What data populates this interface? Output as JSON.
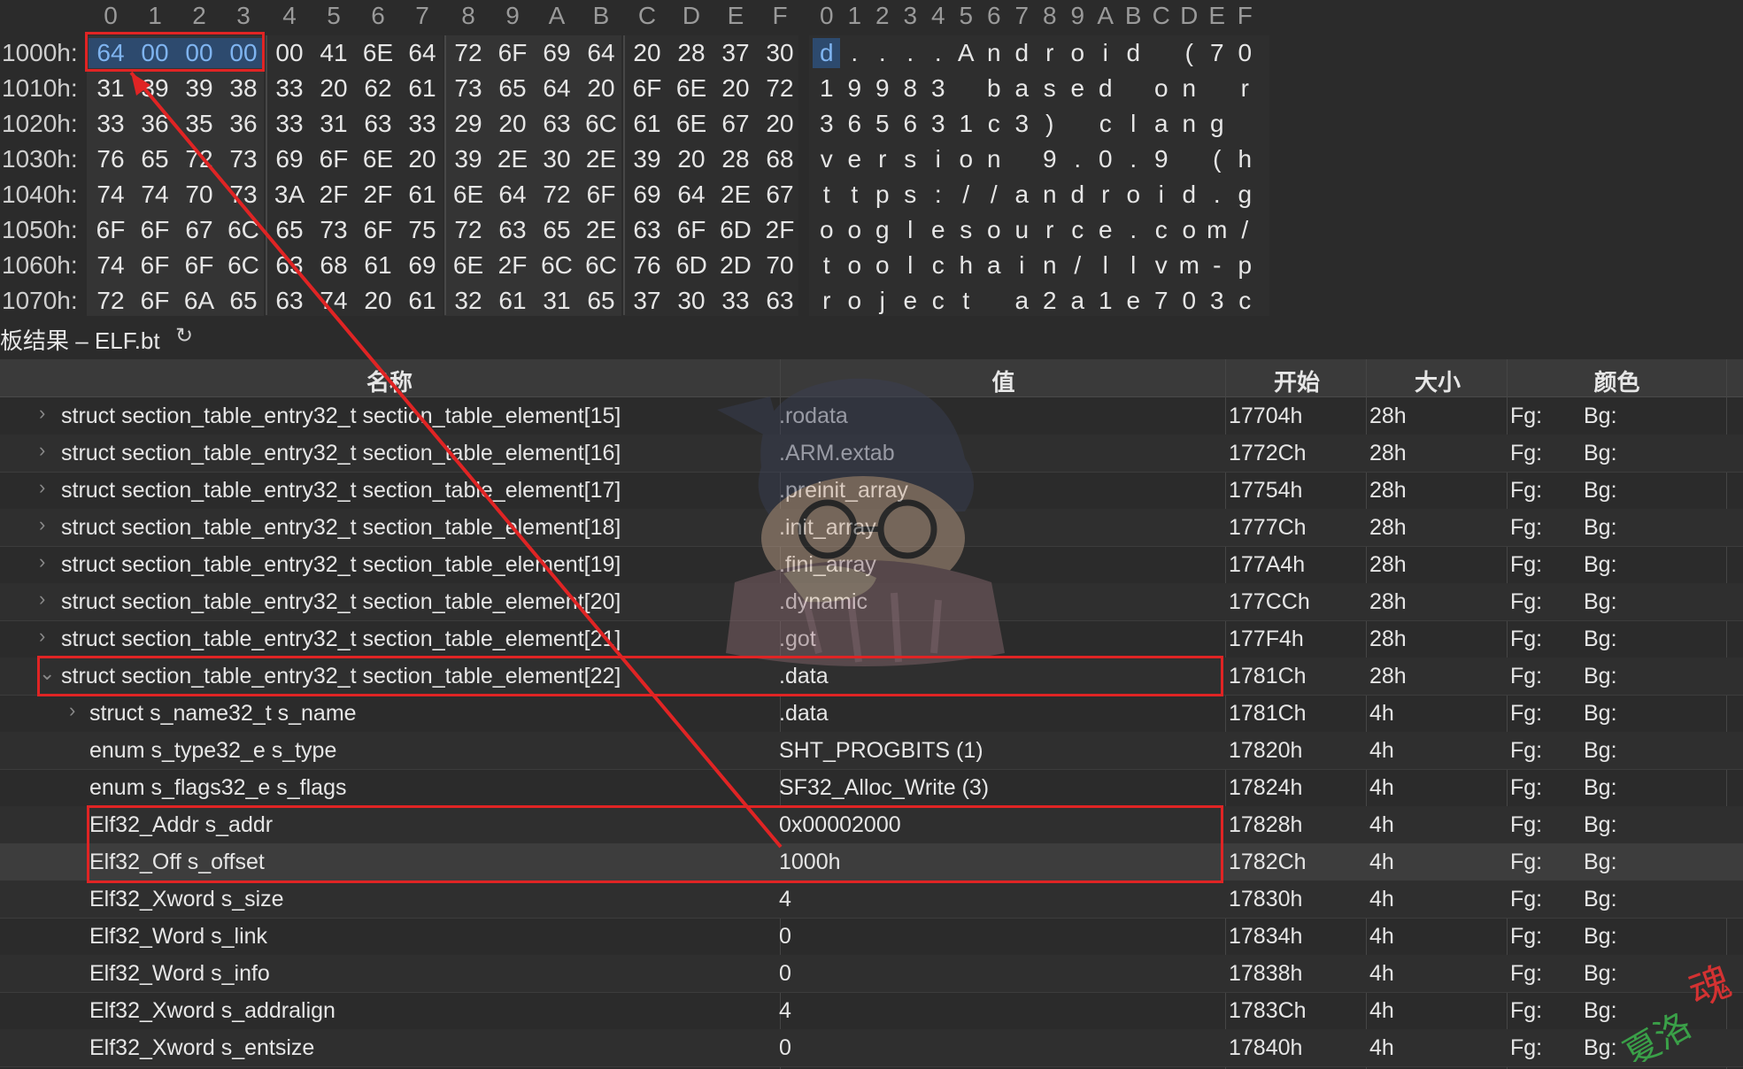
{
  "hex_view": {
    "column_headers": [
      "0",
      "1",
      "2",
      "3",
      "4",
      "5",
      "6",
      "7",
      "8",
      "9",
      "A",
      "B",
      "C",
      "D",
      "E",
      "F"
    ],
    "ascii_headers": [
      "0",
      "1",
      "2",
      "3",
      "4",
      "5",
      "6",
      "7",
      "8",
      "9",
      "A",
      "B",
      "C",
      "D",
      "E",
      "F"
    ],
    "rows": [
      {
        "offset": "1000h:",
        "bytes": [
          "64",
          "00",
          "00",
          "00",
          "00",
          "41",
          "6E",
          "64",
          "72",
          "6F",
          "69",
          "64",
          "20",
          "28",
          "37",
          "30"
        ],
        "ascii": [
          "d",
          ".",
          ".",
          ".",
          ".",
          "A",
          "n",
          "d",
          "r",
          "o",
          "i",
          "d",
          " ",
          "(",
          "7",
          "0"
        ]
      },
      {
        "offset": "1010h:",
        "bytes": [
          "31",
          "39",
          "39",
          "38",
          "33",
          "20",
          "62",
          "61",
          "73",
          "65",
          "64",
          "20",
          "6F",
          "6E",
          "20",
          "72"
        ],
        "ascii": [
          "1",
          "9",
          "9",
          "8",
          "3",
          " ",
          "b",
          "a",
          "s",
          "e",
          "d",
          " ",
          "o",
          "n",
          " ",
          "r"
        ]
      },
      {
        "offset": "1020h:",
        "bytes": [
          "33",
          "36",
          "35",
          "36",
          "33",
          "31",
          "63",
          "33",
          "29",
          "20",
          "63",
          "6C",
          "61",
          "6E",
          "67",
          "20"
        ],
        "ascii": [
          "3",
          "6",
          "5",
          "6",
          "3",
          "1",
          "c",
          "3",
          ")",
          " ",
          "c",
          "l",
          "a",
          "n",
          "g",
          " "
        ]
      },
      {
        "offset": "1030h:",
        "bytes": [
          "76",
          "65",
          "72",
          "73",
          "69",
          "6F",
          "6E",
          "20",
          "39",
          "2E",
          "30",
          "2E",
          "39",
          "20",
          "28",
          "68"
        ],
        "ascii": [
          "v",
          "e",
          "r",
          "s",
          "i",
          "o",
          "n",
          " ",
          "9",
          ".",
          "0",
          ".",
          "9",
          " ",
          "(",
          "h"
        ]
      },
      {
        "offset": "1040h:",
        "bytes": [
          "74",
          "74",
          "70",
          "73",
          "3A",
          "2F",
          "2F",
          "61",
          "6E",
          "64",
          "72",
          "6F",
          "69",
          "64",
          "2E",
          "67"
        ],
        "ascii": [
          "t",
          "t",
          "p",
          "s",
          ":",
          "/",
          "/",
          "a",
          "n",
          "d",
          "r",
          "o",
          "i",
          "d",
          ".",
          "g"
        ]
      },
      {
        "offset": "1050h:",
        "bytes": [
          "6F",
          "6F",
          "67",
          "6C",
          "65",
          "73",
          "6F",
          "75",
          "72",
          "63",
          "65",
          "2E",
          "63",
          "6F",
          "6D",
          "2F"
        ],
        "ascii": [
          "o",
          "o",
          "g",
          "l",
          "e",
          "s",
          "o",
          "u",
          "r",
          "c",
          "e",
          ".",
          "c",
          "o",
          "m",
          "/"
        ]
      },
      {
        "offset": "1060h:",
        "bytes": [
          "74",
          "6F",
          "6F",
          "6C",
          "63",
          "68",
          "61",
          "69",
          "6E",
          "2F",
          "6C",
          "6C",
          "76",
          "6D",
          "2D",
          "70"
        ],
        "ascii": [
          "t",
          "o",
          "o",
          "l",
          "c",
          "h",
          "a",
          "i",
          "n",
          "/",
          "l",
          "l",
          "v",
          "m",
          "-",
          "p"
        ]
      },
      {
        "offset": "1070h:",
        "bytes": [
          "72",
          "6F",
          "6A",
          "65",
          "63",
          "74",
          "20",
          "61",
          "32",
          "61",
          "31",
          "65",
          "37",
          "30",
          "33",
          "63"
        ],
        "ascii": [
          "r",
          "o",
          "j",
          "e",
          "c",
          "t",
          " ",
          "a",
          "2",
          "a",
          "1",
          "e",
          "7",
          "0",
          "3",
          "c"
        ]
      }
    ]
  },
  "results_panel": {
    "title": "板结果 – ELF.bt",
    "refresh_icon": "↻",
    "columns": [
      "名称",
      "值",
      "开始",
      "大小",
      "颜色"
    ]
  },
  "table_rows": [
    {
      "arrow": "›",
      "name": "struct section_table_entry32_t section_table_element[15]",
      "value": ".rodata",
      "start": "17704h",
      "size": "28h",
      "fg": "Fg:",
      "bg": "Bg:"
    },
    {
      "arrow": "›",
      "name": "struct section_table_entry32_t section_table_element[16]",
      "value": ".ARM.extab",
      "start": "1772Ch",
      "size": "28h",
      "fg": "Fg:",
      "bg": "Bg:"
    },
    {
      "arrow": "›",
      "name": "struct section_table_entry32_t section_table_element[17]",
      "value": ".preinit_array",
      "start": "17754h",
      "size": "28h",
      "fg": "Fg:",
      "bg": "Bg:"
    },
    {
      "arrow": "›",
      "name": "struct section_table_entry32_t section_table_element[18]",
      "value": ".init_array",
      "start": "1777Ch",
      "size": "28h",
      "fg": "Fg:",
      "bg": "Bg:"
    },
    {
      "arrow": "›",
      "name": "struct section_table_entry32_t section_table_element[19]",
      "value": ".fini_array",
      "start": "177A4h",
      "size": "28h",
      "fg": "Fg:",
      "bg": "Bg:"
    },
    {
      "arrow": "›",
      "name": "struct section_table_entry32_t section_table_element[20]",
      "value": ".dynamic",
      "start": "177CCh",
      "size": "28h",
      "fg": "Fg:",
      "bg": "Bg:"
    },
    {
      "arrow": "›",
      "name": "struct section_table_entry32_t section_table_element[21]",
      "value": ".got",
      "start": "177F4h",
      "size": "28h",
      "fg": "Fg:",
      "bg": "Bg:"
    },
    {
      "arrow": "⌄",
      "name": "struct section_table_entry32_t section_table_element[22]",
      "value": ".data",
      "start": "1781Ch",
      "size": "28h",
      "fg": "Fg:",
      "bg": "Bg:"
    },
    {
      "arrow": "›",
      "name": "struct s_name32_t s_name",
      "value": ".data",
      "start": "1781Ch",
      "size": "4h",
      "fg": "Fg:",
      "bg": "Bg:"
    },
    {
      "arrow": "",
      "name": "enum s_type32_e s_type",
      "value": "SHT_PROGBITS (1)",
      "start": "17820h",
      "size": "4h",
      "fg": "Fg:",
      "bg": "Bg:"
    },
    {
      "arrow": "",
      "name": "enum s_flags32_e s_flags",
      "value": "SF32_Alloc_Write (3)",
      "start": "17824h",
      "size": "4h",
      "fg": "Fg:",
      "bg": "Bg:"
    },
    {
      "arrow": "",
      "name": "Elf32_Addr s_addr",
      "value": "0x00002000",
      "start": "17828h",
      "size": "4h",
      "fg": "Fg:",
      "bg": "Bg:"
    },
    {
      "arrow": "",
      "name": "Elf32_Off s_offset",
      "value": "1000h",
      "start": "1782Ch",
      "size": "4h",
      "fg": "Fg:",
      "bg": "Bg:"
    },
    {
      "arrow": "",
      "name": "Elf32_Xword s_size",
      "value": "4",
      "start": "17830h",
      "size": "4h",
      "fg": "Fg:",
      "bg": "Bg:"
    },
    {
      "arrow": "",
      "name": "Elf32_Word s_link",
      "value": "0",
      "start": "17834h",
      "size": "4h",
      "fg": "Fg:",
      "bg": "Bg:"
    },
    {
      "arrow": "",
      "name": "Elf32_Word s_info",
      "value": "0",
      "start": "17838h",
      "size": "4h",
      "fg": "Fg:",
      "bg": "Bg:"
    },
    {
      "arrow": "",
      "name": "Elf32_Xword s_addralign",
      "value": "4",
      "start": "1783Ch",
      "size": "4h",
      "fg": "Fg:",
      "bg": "Bg:"
    },
    {
      "arrow": "",
      "name": "Elf32_Xword s_entsize",
      "value": "0",
      "start": "17840h",
      "size": "4h",
      "fg": "Fg:",
      "bg": "Bg:"
    }
  ],
  "colors": {
    "annotation_red": "#e02424",
    "selection_blue": "#2d4a6e",
    "background": "#2b2b2b"
  },
  "watermark": {
    "stamp_text": "夏洛魂"
  }
}
